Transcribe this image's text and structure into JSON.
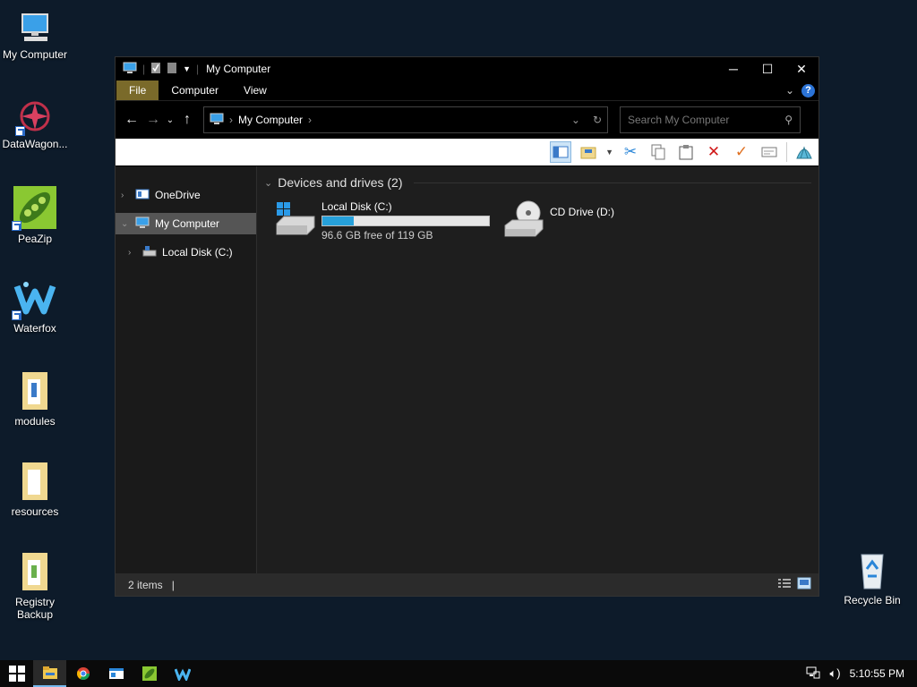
{
  "desktop": {
    "icons": [
      {
        "label": "My Computer"
      },
      {
        "label": "DataWagon..."
      },
      {
        "label": "PeaZip"
      },
      {
        "label": "Waterfox"
      },
      {
        "label": "modules"
      },
      {
        "label": "resources"
      },
      {
        "label": "Registry Backup"
      },
      {
        "label": "Recycle Bin"
      }
    ]
  },
  "window": {
    "title": "My Computer",
    "ribbon_tabs": [
      "File",
      "Computer",
      "View"
    ],
    "address": {
      "crumb": "My Computer"
    },
    "search_placeholder": "Search My Computer"
  },
  "nav": {
    "items": [
      "OneDrive",
      "My Computer",
      "Local Disk (C:)"
    ]
  },
  "main": {
    "group_title": "Devices and drives (2)",
    "drives": [
      {
        "name": "Local Disk (C:)",
        "free": "96.6 GB free of 119 GB",
        "used_fraction": 0.19
      },
      {
        "name": "CD Drive (D:)"
      }
    ]
  },
  "status": {
    "items_count": "2 items"
  },
  "taskbar": {
    "time": "5:10:55 PM"
  },
  "colors": {
    "file_tab": "#7a6a2a",
    "progress": "#26a0da",
    "accent": "#2b73d6"
  }
}
